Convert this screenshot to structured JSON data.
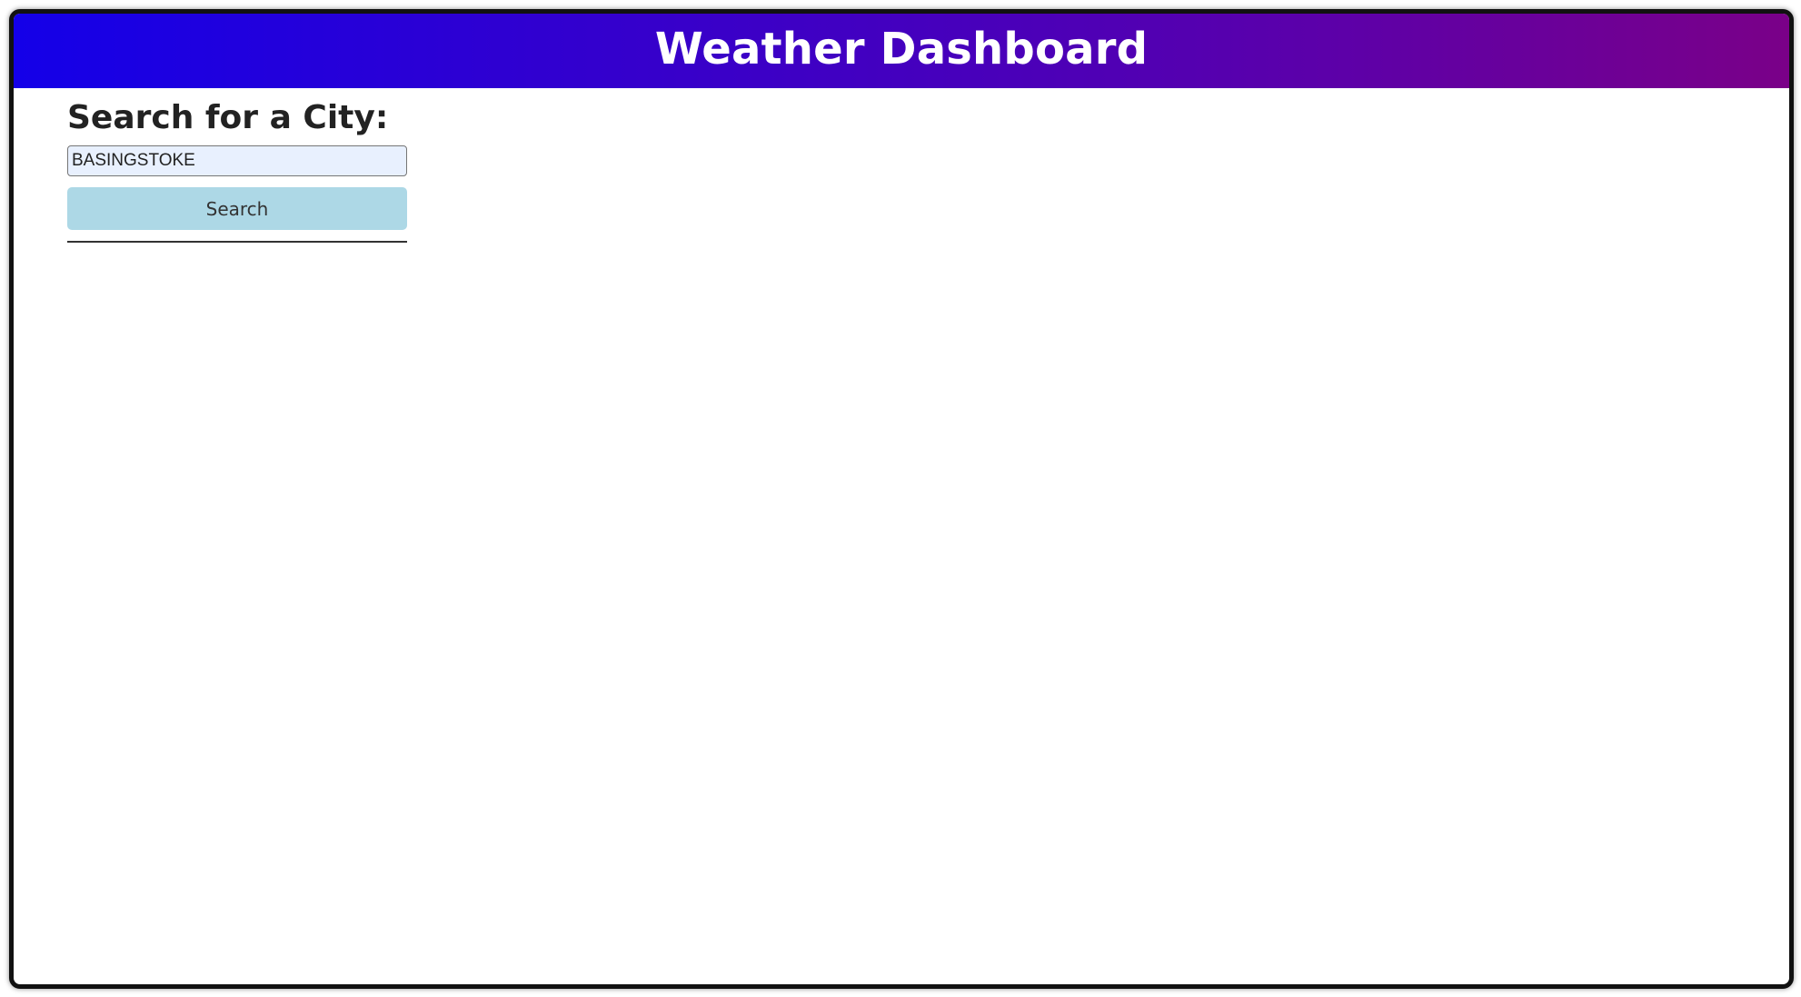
{
  "header": {
    "title": "Weather Dashboard"
  },
  "search": {
    "heading": "Search for a City:",
    "input_value": "BASINGSTOKE",
    "button_label": "Search"
  },
  "colors": {
    "header_gradient_start": "#1400e8",
    "header_gradient_end": "#7a0088",
    "button_background": "#add8e6",
    "input_background": "#e8f0fe"
  }
}
